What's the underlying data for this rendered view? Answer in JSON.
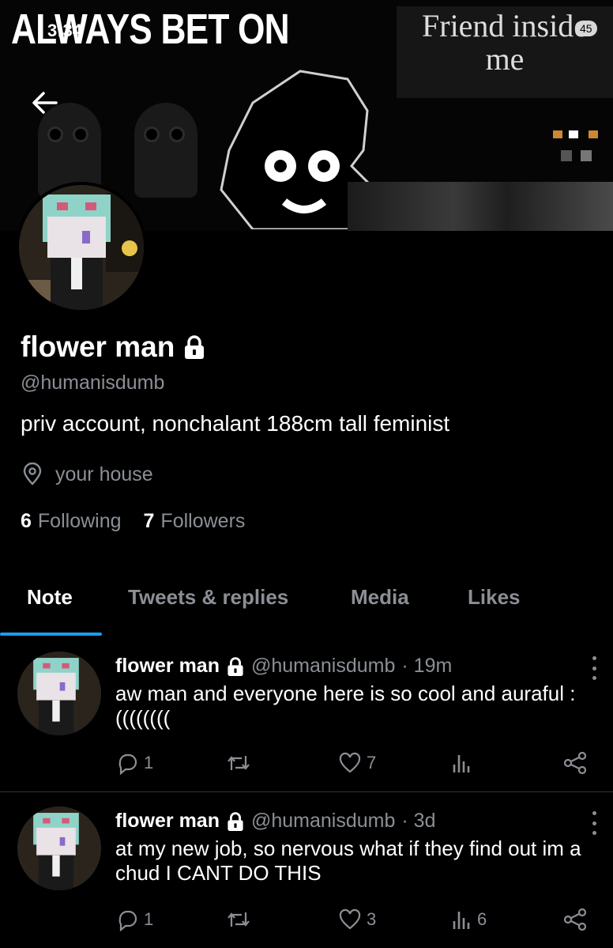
{
  "status_bar": {
    "time": "3:34",
    "battery": "45"
  },
  "banner": {
    "left_text": "ALWAYS BET ON",
    "right_text_line1": "Friend inside",
    "right_text_line2": "me"
  },
  "profile": {
    "display_name": "flower man",
    "handle": "@humanisdumb",
    "bio": "priv account, nonchalant 188cm tall feminist",
    "location": "your house",
    "following_count": "6",
    "following_label": "Following",
    "followers_count": "7",
    "followers_label": "Followers"
  },
  "tabs": [
    {
      "label": "Note",
      "active": true
    },
    {
      "label": "Tweets & replies",
      "active": false
    },
    {
      "label": "Media",
      "active": false
    },
    {
      "label": "Likes",
      "active": false
    }
  ],
  "tweets": [
    {
      "name": "flower man",
      "handle": "@humanisdumb",
      "time": "· 19m",
      "text": "aw man and everyone here is so cool and auraful :((((((((",
      "replies": "1",
      "retweets": "",
      "likes": "7",
      "views": ""
    },
    {
      "name": "flower man",
      "handle": "@humanisdumb",
      "time": "· 3d",
      "text": "at my new job, so nervous what if they find out im a chud I CANT DO THIS",
      "replies": "1",
      "retweets": "",
      "likes": "3",
      "views": "6"
    }
  ],
  "colors": {
    "accent": "#1d9bf0",
    "muted": "#8b8f95",
    "background": "#000000"
  },
  "icons": [
    "back-arrow-icon",
    "lock-icon",
    "location-pin-icon",
    "reply-icon",
    "retweet-icon",
    "like-icon",
    "views-icon",
    "share-icon",
    "more-icon"
  ]
}
